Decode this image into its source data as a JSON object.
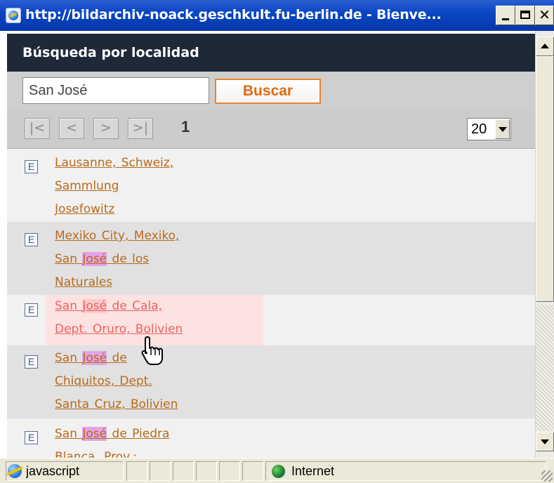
{
  "window": {
    "title": "http://bildarchiv-noack.geschkult.fu-berlin.de - Bienve..."
  },
  "panel": {
    "header": "Búsqueda por localidad"
  },
  "search": {
    "value": "San José",
    "button_label": "Buscar"
  },
  "pager": {
    "first_label": "|<",
    "prev_label": "<",
    "next_label": ">",
    "last_label": ">|",
    "current_page": "1",
    "per_page": "20"
  },
  "results": [
    {
      "icon_letter": "E",
      "lines": [
        "Lausanne, Schweiz,",
        "Sammlung",
        "Josefowitz"
      ],
      "link_text": "Lausanne, Schweiz, Sammlung Josefowitz"
    },
    {
      "icon_letter": "E",
      "link_text": "Mexiko City, Mexiko, San José de los Naturales",
      "parts": [
        "Mexiko City, Mexiko,",
        "San ",
        "José",
        " de los",
        "Naturales"
      ]
    },
    {
      "icon_letter": "E",
      "link_text": "San José de Cala, Dept. Oruro, Bolivien",
      "parts": [
        "San ",
        "José",
        " de Cala,",
        "Dept. Oruro, Bolivien"
      ]
    },
    {
      "icon_letter": "E",
      "link_text": "San José de Chiquitos, Dept. Santa Cruz, Bolivien",
      "parts": [
        "San ",
        "José",
        " de",
        "Chiquitos, Dept.",
        "Santa Cruz, Bolivien"
      ]
    },
    {
      "icon_letter": "E",
      "link_text": "San José de Piedra Blanca, Prov.:",
      "parts": [
        "San ",
        "José",
        " de Piedra",
        "Blanca, Prov.:"
      ]
    }
  ],
  "statusbar": {
    "text": "javascript",
    "zone": "Internet"
  },
  "colors": {
    "header_bg": "#1e2837",
    "link": "#b86b1a",
    "link_hover": "#ee6060",
    "highlight_purple": "#e3a3e8",
    "button_border": "#e9832c"
  },
  "icons": {
    "title": "ie-page-icon",
    "result": "letter-e-box-icon",
    "cursor": "hand-pointer-icon",
    "status": "ie-icon",
    "zone": "internet-globe-icon"
  }
}
